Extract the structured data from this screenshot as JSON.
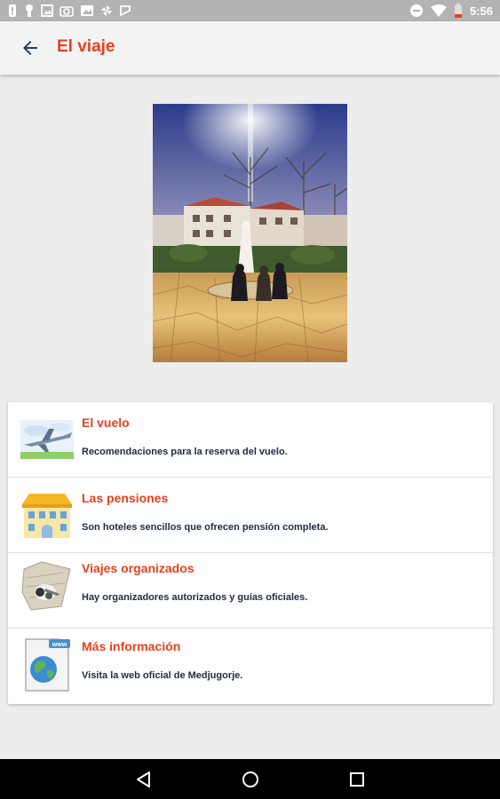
{
  "status_bar": {
    "time": "5:56",
    "left_icons": [
      "notification-icon",
      "lock-icon",
      "image-icon",
      "camera-icon",
      "gallery-icon",
      "pinwheel-icon",
      "shield-icon"
    ],
    "right_icons": [
      "do-not-disturb-icon",
      "wifi-icon",
      "battery-icon"
    ]
  },
  "app_bar": {
    "title": "El viaje",
    "back_icon": "arrow-back-icon"
  },
  "hero": {
    "image": "medjugorje-statue-photo"
  },
  "list": {
    "items": [
      {
        "title": "El vuelo",
        "description": "Recomendaciones para la reserva del vuelo.",
        "icon": "airplane-icon"
      },
      {
        "title": "Las pensiones",
        "description": "Son hoteles sencillos que ofrecen pensión completa.",
        "icon": "hotel-building-icon"
      },
      {
        "title": "Viajes organizados",
        "description": "Hay organizadores autorizados y guías oficiales.",
        "icon": "map-keys-icon"
      },
      {
        "title": "Más información",
        "description": "Visita la web oficial de Medjugorje.",
        "icon": "web-globe-icon"
      }
    ]
  },
  "nav_bar": {
    "icons": [
      "back-triangle-icon",
      "home-circle-icon",
      "recents-square-icon"
    ]
  },
  "colors": {
    "accent": "#e8401c",
    "text_dark": "#1f2a44",
    "background": "#ededed"
  }
}
